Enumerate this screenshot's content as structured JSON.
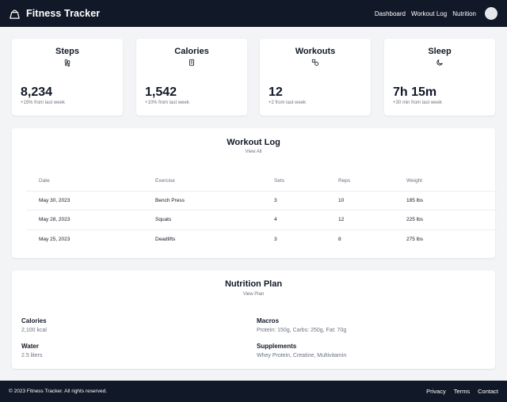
{
  "header": {
    "brand_icon": "kettlebell-icon",
    "title": "Fitness Tracker",
    "nav": [
      "Dashboard",
      "Workout Log",
      "Nutrition"
    ]
  },
  "stats": [
    {
      "title": "Steps",
      "icon": "footprints-icon",
      "value": "8,234",
      "change": "+15% from last week"
    },
    {
      "title": "Calories",
      "icon": "phone-icon",
      "value": "1,542",
      "change": "+10% from last week"
    },
    {
      "title": "Workouts",
      "icon": "shapes-icon",
      "value": "12",
      "change": "+2 from last week"
    },
    {
      "title": "Sleep",
      "icon": "moon-icon",
      "value": "7h 15m",
      "change": "+30 min from last week"
    }
  ],
  "workout_log": {
    "title": "Workout Log",
    "link": "View All",
    "columns": [
      "Date",
      "Exercise",
      "Sets",
      "Reps",
      "Weight"
    ],
    "rows": [
      [
        "May 30, 2023",
        "Bench Press",
        "3",
        "10",
        "185 lbs"
      ],
      [
        "May 28, 2023",
        "Squats",
        "4",
        "12",
        "225 lbs"
      ],
      [
        "May 25, 2023",
        "Deadlifts",
        "3",
        "8",
        "275 lbs"
      ]
    ]
  },
  "nutrition": {
    "title": "Nutrition Plan",
    "link": "View Plan",
    "items": [
      {
        "label": "Calories",
        "value": "2,100 kcal"
      },
      {
        "label": "Macros",
        "value": "Protein: 150g, Carbs: 250g, Fat: 70g"
      },
      {
        "label": "Water",
        "value": "2.5 liters"
      },
      {
        "label": "Supplements",
        "value": "Whey Protein, Creatine, Multivitamin"
      }
    ]
  },
  "footer": {
    "copyright": "© 2023 Fitness Tracker. All rights reserved.",
    "links": [
      "Privacy",
      "Terms",
      "Contact"
    ]
  },
  "colors": {
    "header_bg": "#111827",
    "page_bg": "#f3f4f6",
    "card_bg": "#ffffff",
    "muted_text": "#6b7280"
  }
}
